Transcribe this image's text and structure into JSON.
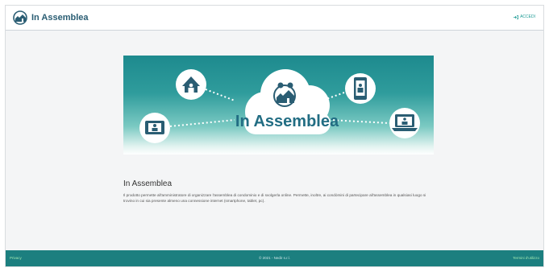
{
  "header": {
    "app_title": "In Assemblea",
    "login_label": "ACCEDI"
  },
  "hero": {
    "cloud_label": "In Assemblea"
  },
  "main": {
    "title": "In Assemblea",
    "description": "Il prodotto permette all'amministratore di organizzare l'assemblea di condominio e di svolgerla online. Permette, inoltre, ai condòmini di partecipare all'assemblea in qualsiasi luogo si trovino in cui sia presente almeno una connessione internet (smartphone, tablet, pc)."
  },
  "footer": {
    "left_link": "Privacy",
    "copyright": "© 2021 - Nedir s.r.l.",
    "right_link": "Termini d'utilizzo"
  },
  "colors": {
    "brand": "#2a5d73",
    "accent": "#1b9a94",
    "footer_bg": "#1c7f7f"
  }
}
